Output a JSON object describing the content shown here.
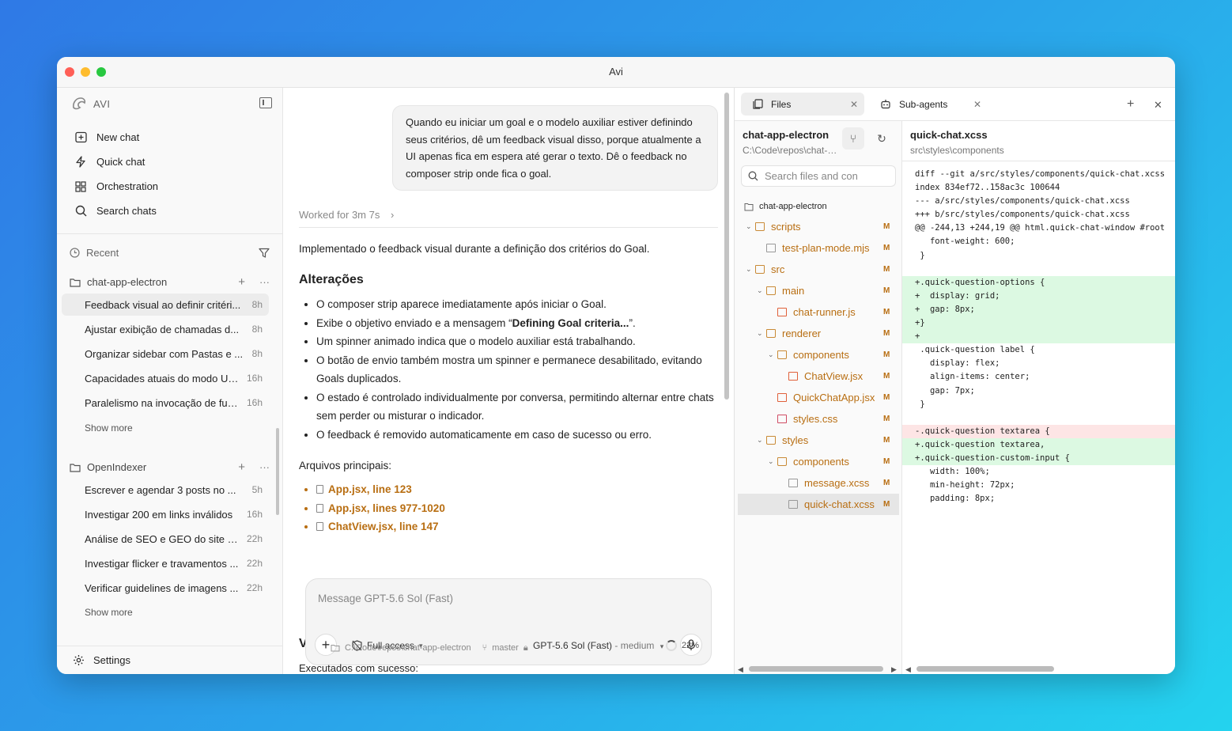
{
  "window": {
    "title": "Avi"
  },
  "sidebar": {
    "brand": "AVI",
    "nav": [
      {
        "label": "New chat",
        "icon": "new-chat-icon"
      },
      {
        "label": "Quick chat",
        "icon": "lightning-icon"
      },
      {
        "label": "Orchestration",
        "icon": "grid-icon"
      },
      {
        "label": "Search chats",
        "icon": "search-icon"
      }
    ],
    "recent_label": "Recent",
    "groups": [
      {
        "name": "chat-app-electron",
        "chats": [
          {
            "title": "Feedback visual ao definir critéri...",
            "time": "8h"
          },
          {
            "title": "Ajustar exibição de chamadas d...",
            "time": "8h"
          },
          {
            "title": "Organizar sidebar com Pastas e ...",
            "time": "8h"
          },
          {
            "title": "Capacidades atuais do modo Ult...",
            "time": "16h"
          },
          {
            "title": "Paralelismo na invocação de fun...",
            "time": "16h"
          }
        ],
        "show_more": "Show more"
      },
      {
        "name": "OpenIndexer",
        "chats": [
          {
            "title": "Escrever e agendar 3 posts no ...",
            "time": "5h"
          },
          {
            "title": "Investigar 200 em links inválidos",
            "time": "16h"
          },
          {
            "title": "Análise de SEO e GEO do site e ...",
            "time": "22h"
          },
          {
            "title": "Investigar flicker e travamentos ...",
            "time": "22h"
          },
          {
            "title": "Verificar guidelines de imagens ...",
            "time": "22h"
          }
        ],
        "show_more": "Show more"
      }
    ],
    "settings": "Settings"
  },
  "chat": {
    "user_message": "Quando eu iniciar um goal e o modelo auxiliar estiver definindo seus critérios, dê um feedback visual disso, porque atualmente a UI apenas fica em espera até gerar o texto. Dê o feedback no composer strip onde fica o goal.",
    "worked": "Worked for 3m 7s",
    "intro": "Implementado o feedback visual durante a definição dos critérios do Goal.",
    "h_alteracoes": "Alterações",
    "bullets": [
      "O composer strip aparece imediatamente após iniciar o Goal.",
      "Exibe o objetivo enviado e a mensagem “",
      "Um spinner animado indica que o modelo auxiliar está trabalhando.",
      "O botão de envio também mostra um spinner e permanece desabilitado, evitando Goals duplicados.",
      "O estado é controlado individualmente por conversa, permitindo alternar entre chats sem perder ou misturar o indicador.",
      "O feedback é removido automaticamente em caso de sucesso ou erro."
    ],
    "bullet2_bold": "Defining Goal criteria...",
    "bullet2_end": "”.",
    "files_label": "Arquivos principais:",
    "files": [
      "App.jsx, line 123",
      "App.jsx, lines 977-1020",
      "ChatView.jsx, line 147"
    ],
    "valid_heading": "Val",
    "exec": "Executados com sucesso:",
    "composer": {
      "placeholder": "Message GPT-5.6 Sol (Fast)",
      "access": "Full access",
      "model": "GPT-5.6 Sol (Fast)",
      "effort": " - medium"
    },
    "status": {
      "path": "C:\\Code\\repos\\chat-app-electron",
      "branch": "master",
      "context": "22%"
    }
  },
  "panel": {
    "tabs": [
      {
        "label": "Files"
      },
      {
        "label": "Sub-agents"
      }
    ],
    "repo": "chat-app-electron",
    "repo_path": "C:\\Code\\repos\\chat-app-electron",
    "search_placeholder": "Search files and con",
    "root": "chat-app-electron",
    "modified_mark": "M",
    "tree": [
      {
        "name": "scripts",
        "type": "folder",
        "depth": 1
      },
      {
        "name": "test-plan-mode.mjs",
        "type": "file",
        "depth": 2
      },
      {
        "name": "src",
        "type": "folder",
        "depth": 1
      },
      {
        "name": "main",
        "type": "folder",
        "depth": 2
      },
      {
        "name": "chat-runner.js",
        "type": "js",
        "depth": 3
      },
      {
        "name": "renderer",
        "type": "folder",
        "depth": 2
      },
      {
        "name": "components",
        "type": "folder",
        "depth": 3
      },
      {
        "name": "ChatView.jsx",
        "type": "js",
        "depth": 4
      },
      {
        "name": "QuickChatApp.jsx",
        "type": "js",
        "depth": 3
      },
      {
        "name": "styles.css",
        "type": "css",
        "depth": 3
      },
      {
        "name": "styles",
        "type": "folder",
        "depth": 2
      },
      {
        "name": "components",
        "type": "folder",
        "depth": 3
      },
      {
        "name": "message.xcss",
        "type": "file",
        "depth": 4
      },
      {
        "name": "quick-chat.xcss",
        "type": "file",
        "depth": 4,
        "selected": true
      }
    ],
    "diff_file": "quick-chat.xcss",
    "diff_path": "src\\styles\\components",
    "diff": [
      {
        "t": "diff --git a/src/styles/components/quick-chat.xcss",
        "k": "ctx"
      },
      {
        "t": "index 834ef72..158ac3c 100644",
        "k": "ctx"
      },
      {
        "t": "--- a/src/styles/components/quick-chat.xcss",
        "k": "ctx"
      },
      {
        "t": "+++ b/src/styles/components/quick-chat.xcss",
        "k": "ctx"
      },
      {
        "t": "@@ -244,13 +244,19 @@ html.quick-chat-window #root",
        "k": "ctx"
      },
      {
        "t": "   font-weight: 600;",
        "k": "ctx"
      },
      {
        "t": " }",
        "k": "ctx"
      },
      {
        "t": "",
        "k": "ctx"
      },
      {
        "t": "+.quick-question-options {",
        "k": "add"
      },
      {
        "t": "+  display: grid;",
        "k": "add"
      },
      {
        "t": "+  gap: 8px;",
        "k": "add"
      },
      {
        "t": "+}",
        "k": "add"
      },
      {
        "t": "+",
        "k": "add"
      },
      {
        "t": " .quick-question label {",
        "k": "ctx"
      },
      {
        "t": "   display: flex;",
        "k": "ctx"
      },
      {
        "t": "   align-items: center;",
        "k": "ctx"
      },
      {
        "t": "   gap: 7px;",
        "k": "ctx"
      },
      {
        "t": " }",
        "k": "ctx"
      },
      {
        "t": "",
        "k": "ctx"
      },
      {
        "t": "-.quick-question textarea {",
        "k": "del"
      },
      {
        "t": "+.quick-question textarea,",
        "k": "add"
      },
      {
        "t": "+.quick-question-custom-input {",
        "k": "add"
      },
      {
        "t": "   width: 100%;",
        "k": "ctx"
      },
      {
        "t": "   min-height: 72px;",
        "k": "ctx"
      },
      {
        "t": "   padding: 8px;",
        "k": "ctx"
      }
    ]
  }
}
